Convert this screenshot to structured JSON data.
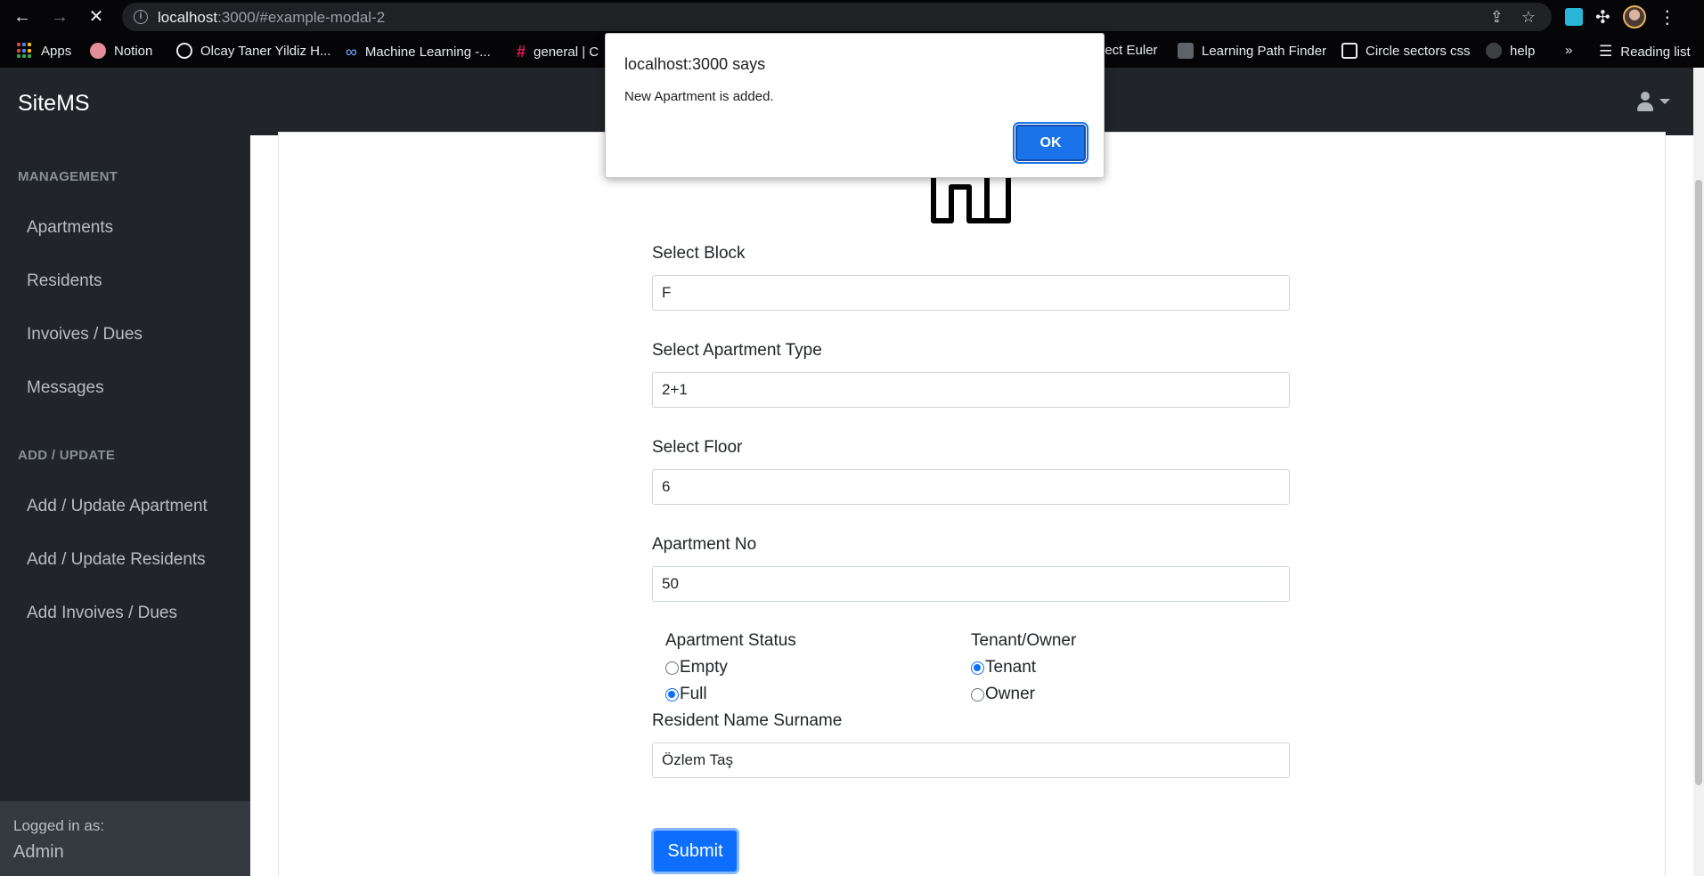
{
  "browser": {
    "url_host": "localhost",
    "url_path": ":3000/#example-modal-2",
    "back_icon": "back-arrow-icon",
    "forward_icon": "forward-arrow-icon",
    "stop_icon": "close-icon",
    "bookmarks": [
      {
        "label": "Apps",
        "icon": "apps-grid-icon"
      },
      {
        "label": "Notion",
        "icon": "notion-icon"
      },
      {
        "label": "Olcay Taner Yildiz H...",
        "icon": "globe-icon"
      },
      {
        "label": "Machine Learning -...",
        "icon": "infinity-icon"
      },
      {
        "label": "general | C",
        "icon": "slack-icon"
      },
      {
        "label": "ject Euler",
        "icon": "project-euler-icon"
      },
      {
        "label": "Learning Path Finder",
        "icon": "path-finder-icon"
      },
      {
        "label": "Circle sectors css",
        "icon": "codepen-icon"
      },
      {
        "label": "help",
        "icon": "github-icon"
      }
    ],
    "overflow_label": "»",
    "reading_list_label": "Reading list"
  },
  "app": {
    "brand": "SiteMS",
    "sidebar": {
      "management_heading": "MANAGEMENT",
      "management_items": [
        "Apartments",
        "Residents",
        "Invoives / Dues",
        "Messages"
      ],
      "add_update_heading": "ADD / UPDATE",
      "add_update_items": [
        "Add / Update Apartment",
        "Add / Update Residents",
        "Add Invoives / Dues"
      ],
      "logged_in_label": "Logged in as:",
      "logged_in_user": "Admin"
    }
  },
  "form": {
    "block_label": "Select Block",
    "block_value": "F",
    "type_label": "Select Apartment Type",
    "type_value": "2+1",
    "floor_label": "Select Floor",
    "floor_value": "6",
    "no_label": "Apartment No",
    "no_value": "50",
    "status_title": "Apartment Status",
    "status_options": [
      "Empty",
      "Full"
    ],
    "status_selected": "Full",
    "tenancy_title": "Tenant/Owner",
    "tenancy_options": [
      "Tenant",
      "Owner"
    ],
    "tenancy_selected": "Tenant",
    "resident_label": "Resident Name Surname",
    "resident_value": "Özlem Taş",
    "submit_label": "Submit"
  },
  "dialog": {
    "title": "localhost:3000 says",
    "message": "New Apartment is added.",
    "ok_label": "OK"
  },
  "colors": {
    "sidebar_bg": "#212529",
    "primary": "#0d6efd",
    "dialog_button": "#1a73e8"
  }
}
